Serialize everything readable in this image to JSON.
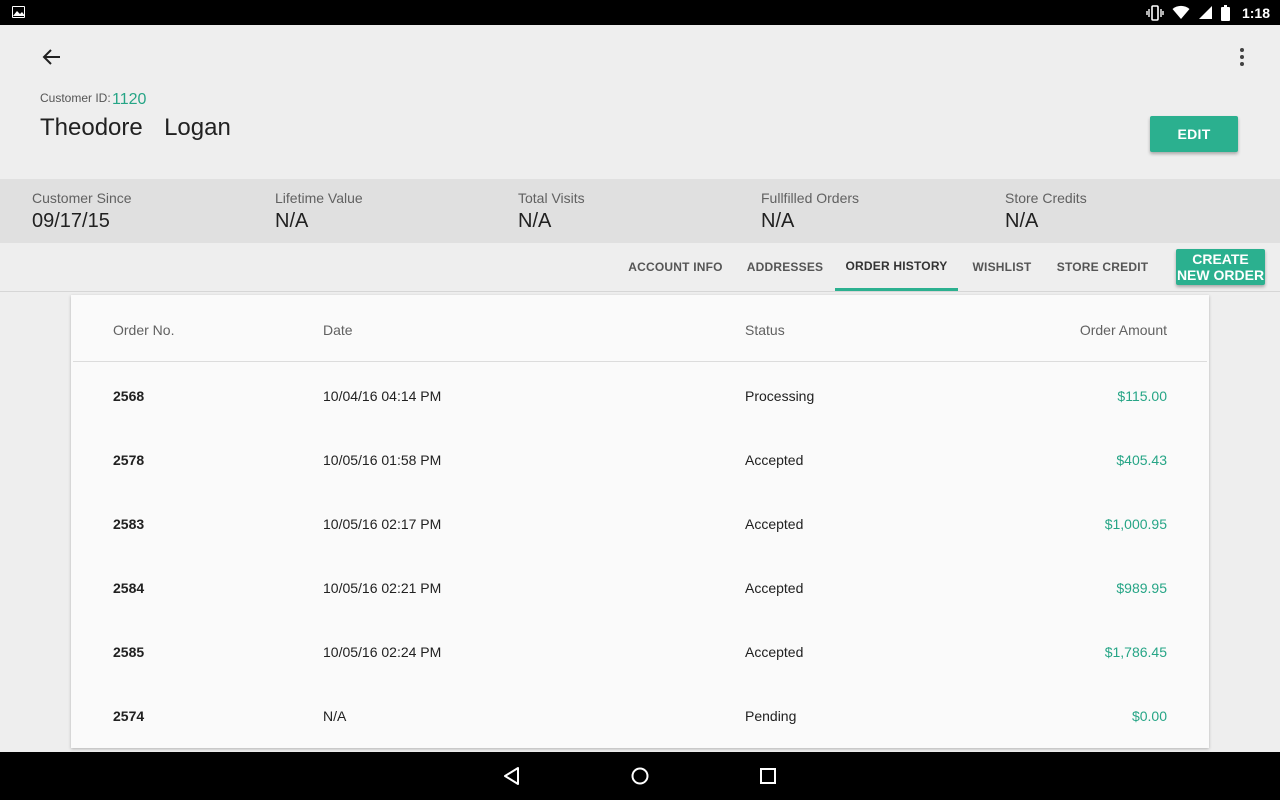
{
  "status_bar": {
    "time": "1:18"
  },
  "header": {
    "customer_id_label": "Customer ID:",
    "customer_id": "1120",
    "name": "Theodore  Logan",
    "edit_label": "EDIT"
  },
  "stats": [
    {
      "label": "Customer Since",
      "value": "09/17/15"
    },
    {
      "label": "Lifetime Value",
      "value": "N/A"
    },
    {
      "label": "Total Visits",
      "value": "N/A"
    },
    {
      "label": "Fullfilled Orders",
      "value": "N/A"
    },
    {
      "label": "Store Credits",
      "value": "N/A"
    }
  ],
  "tabs": [
    {
      "label": "ACCOUNT INFO"
    },
    {
      "label": "ADDRESSES"
    },
    {
      "label": "ORDER HISTORY",
      "active": true
    },
    {
      "label": "WISHLIST"
    },
    {
      "label": "STORE CREDIT"
    }
  ],
  "create_order": {
    "line1": "CREATE",
    "line2": "NEW ORDER"
  },
  "table": {
    "headers": {
      "order_no": "Order No.",
      "date": "Date",
      "status": "Status",
      "amount": "Order Amount"
    },
    "rows": [
      {
        "order_no": "2568",
        "date": "10/04/16 04:14 PM",
        "status": "Processing",
        "amount": "$115.00"
      },
      {
        "order_no": "2578",
        "date": "10/05/16 01:58 PM",
        "status": "Accepted",
        "amount": "$405.43"
      },
      {
        "order_no": "2583",
        "date": "10/05/16 02:17 PM",
        "status": "Accepted",
        "amount": "$1,000.95"
      },
      {
        "order_no": "2584",
        "date": "10/05/16 02:21 PM",
        "status": "Accepted",
        "amount": "$989.95"
      },
      {
        "order_no": "2585",
        "date": "10/05/16 02:24 PM",
        "status": "Accepted",
        "amount": "$1,786.45"
      },
      {
        "order_no": "2574",
        "date": "N/A",
        "status": "Pending",
        "amount": "$0.00"
      }
    ]
  },
  "colors": {
    "accent": "#2bb08f",
    "accent_text": "#26a586"
  },
  "icons": {
    "status_left": "image-icon",
    "status_right": [
      "vibrate-icon",
      "wifi-icon",
      "signal-icon",
      "battery-icon"
    ],
    "back": "arrow-back-icon",
    "more": "more-vert-icon",
    "nav": [
      "nav-back-icon",
      "nav-home-icon",
      "nav-recents-icon"
    ]
  }
}
